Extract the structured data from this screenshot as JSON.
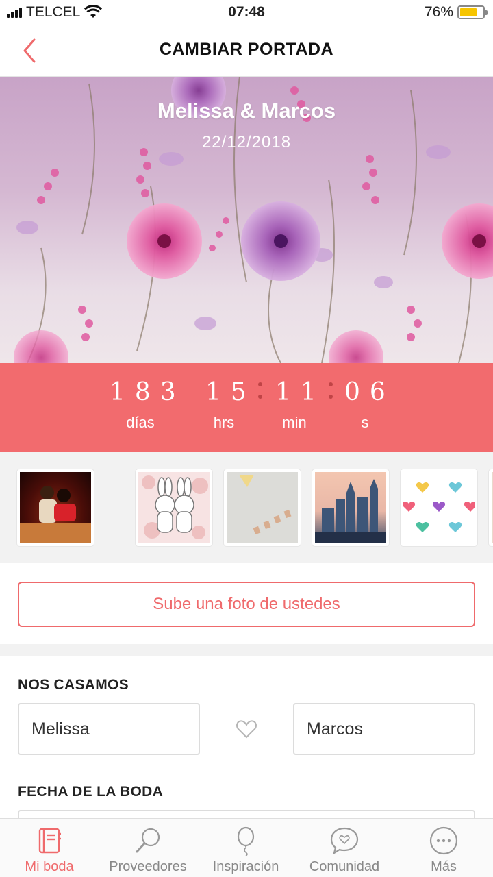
{
  "status_bar": {
    "carrier": "TELCEL",
    "time": "07:48",
    "battery": "76%",
    "battery_level": 0.76
  },
  "nav": {
    "title": "CAMBIAR PORTADA"
  },
  "cover": {
    "names": "Melissa & Marcos",
    "date": "22/12/2018"
  },
  "countdown": {
    "days": "183",
    "days_label": "días",
    "hours": "15",
    "hours_label": "hrs",
    "minutes": "11",
    "minutes_label": "min",
    "seconds": "06",
    "seconds_label": "s"
  },
  "thumbnails": [
    "couple-photo",
    "bunnies-pattern",
    "bunting-flags",
    "city-skyline",
    "hearts-pattern",
    "partial-thumbnail"
  ],
  "upload": {
    "button_label": "Sube una foto de ustedes"
  },
  "form": {
    "section_couple": "NOS CASAMOS",
    "partner1": "Melissa",
    "partner2": "Marcos",
    "section_date": "FECHA DE LA BODA"
  },
  "tabs": [
    {
      "label": "Mi boda",
      "icon": "notebook-icon",
      "active": true
    },
    {
      "label": "Proveedores",
      "icon": "magnifier-icon",
      "active": false
    },
    {
      "label": "Inspiración",
      "icon": "balloon-icon",
      "active": false
    },
    {
      "label": "Comunidad",
      "icon": "chat-heart-icon",
      "active": false
    },
    {
      "label": "Más",
      "icon": "more-dots-icon",
      "active": false
    }
  ],
  "colors": {
    "accent": "#ef6a6c",
    "countdown_bg": "#f26b6e",
    "battery": "#f7c500"
  }
}
